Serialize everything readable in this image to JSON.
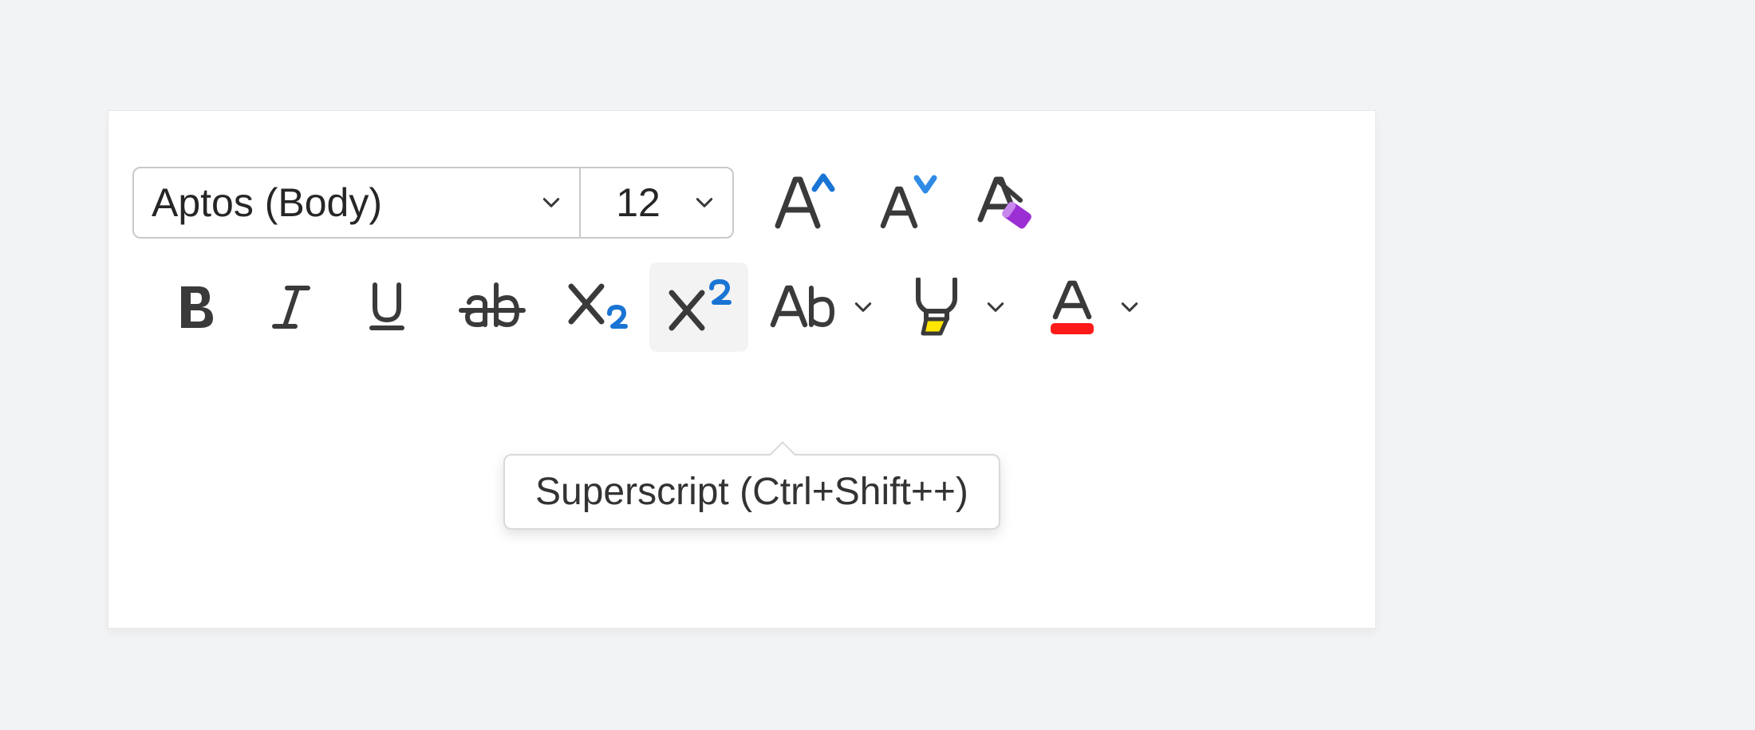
{
  "font": {
    "name": "Aptos (Body)",
    "size": "12"
  },
  "tooltip": "Superscript (Ctrl+Shift++)",
  "icons": {
    "grow_font": "increase-font-size-icon",
    "shrink_font": "decrease-font-size-icon",
    "clear_format": "clear-formatting-icon",
    "bold": "bold-icon",
    "italic": "italic-icon",
    "underline": "underline-icon",
    "strike": "strikethrough-icon",
    "subscript": "subscript-icon",
    "superscript": "superscript-icon",
    "change_case": "change-case-icon",
    "highlight": "highlight-icon",
    "font_color": "font-color-icon",
    "chevron": "chevron-down-icon"
  },
  "colors": {
    "text": "#3a3a3a",
    "accent_blue": "#1a74d4",
    "accent_blue_light": "#2f8be6",
    "eraser": "#9b2fd4",
    "highlight_yellow": "#ffe600",
    "font_color_swatch": "#ff1a1a"
  }
}
